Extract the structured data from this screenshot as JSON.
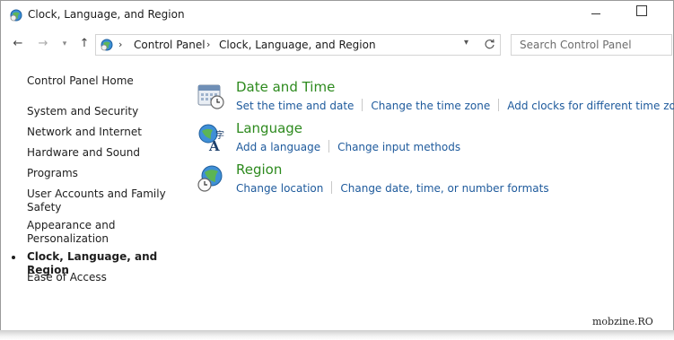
{
  "window": {
    "title": "Clock, Language, and Region",
    "icon": "control-panel-icon"
  },
  "address_bar": {
    "breadcrumbs": [
      "Control Panel",
      "Clock, Language, and Region"
    ],
    "search_placeholder": "Search Control Panel"
  },
  "sidebar": {
    "home_label": "Control Panel Home",
    "items": [
      {
        "label": "System and Security",
        "current": false
      },
      {
        "label": "Network and Internet",
        "current": false
      },
      {
        "label": "Hardware and Sound",
        "current": false
      },
      {
        "label": "Programs",
        "current": false
      },
      {
        "label": "User Accounts and Family\nSafety",
        "current": false
      },
      {
        "label": "Appearance and\nPersonalization",
        "current": false
      },
      {
        "label": "Clock, Language, and Region",
        "current": true
      },
      {
        "label": "Ease of Access",
        "current": false
      }
    ]
  },
  "categories": [
    {
      "title": "Date and Time",
      "icon": "date-time-icon",
      "links": [
        "Set the time and date",
        "Change the time zone",
        "Add clocks for different time zones"
      ]
    },
    {
      "title": "Language",
      "icon": "language-icon",
      "links": [
        "Add a language",
        "Change input methods"
      ]
    },
    {
      "title": "Region",
      "icon": "region-globe-icon",
      "links": [
        "Change location",
        "Change date, time, or number formats"
      ]
    }
  ],
  "colors": {
    "category_title": "#2d8a1e",
    "link": "#1e5a9c"
  },
  "watermark": "mobzine.RO"
}
